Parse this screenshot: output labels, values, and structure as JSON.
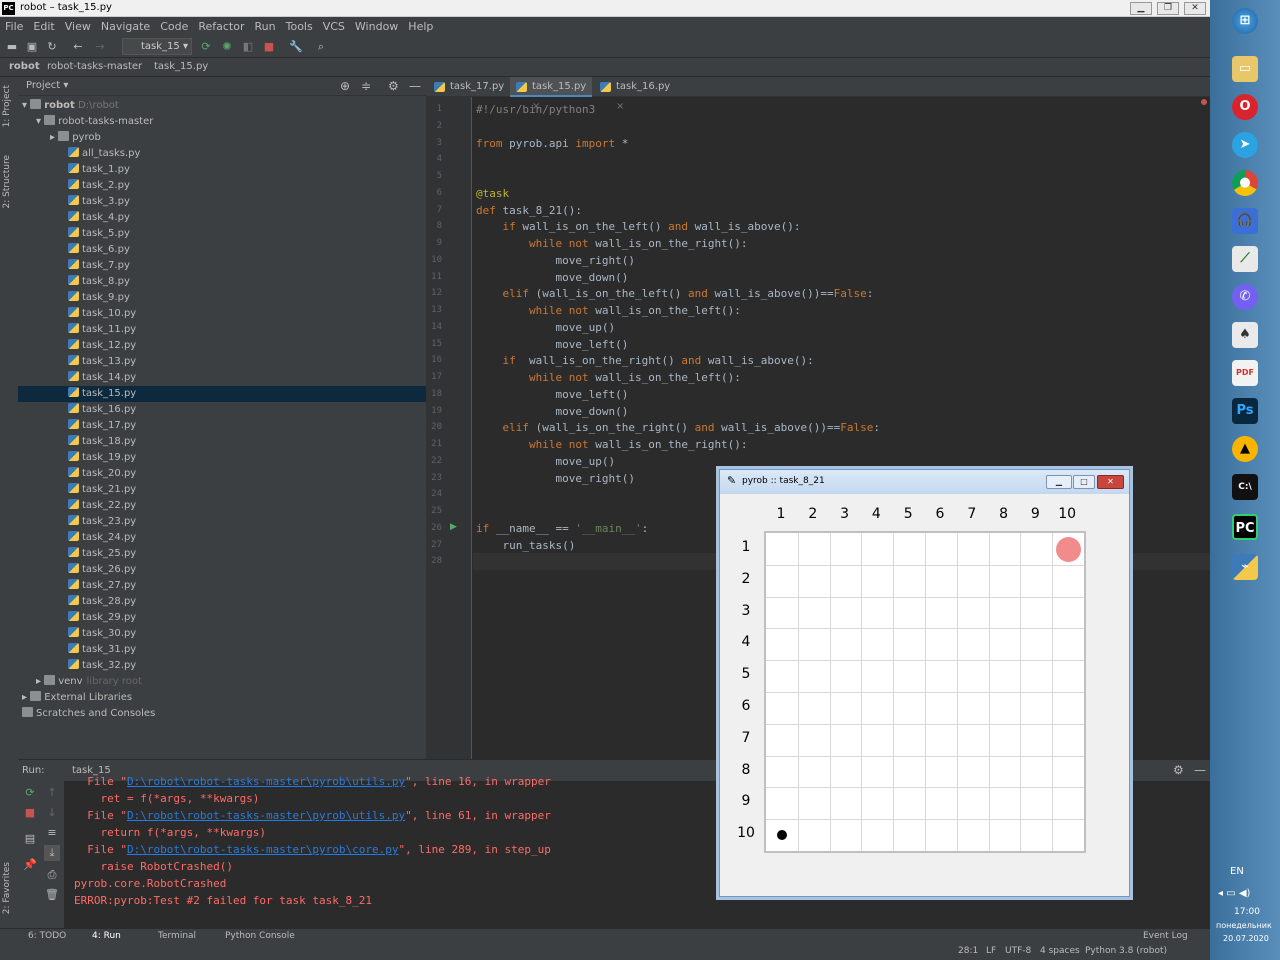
{
  "window": {
    "title": "robot – task_15.py",
    "app_icon": "PC"
  },
  "menu": [
    "File",
    "Edit",
    "View",
    "Navigate",
    "Code",
    "Refactor",
    "Run",
    "Tools",
    "VCS",
    "Window",
    "Help"
  ],
  "toolbar": {
    "run_config": "task_15"
  },
  "breadcrumbs": [
    "robot",
    "robot-tasks-master",
    "task_15.py"
  ],
  "left_tabs": [
    "1: Project",
    "2: Structure",
    "2: Favorites"
  ],
  "project": {
    "header": "Project",
    "root": {
      "name": "robot",
      "path": "D:\\robot"
    },
    "items": [
      {
        "label": "robot-tasks-master",
        "type": "dir",
        "indent": 1
      },
      {
        "label": "pyrob",
        "type": "dir",
        "indent": 2
      },
      {
        "label": "all_tasks.py",
        "type": "py",
        "indent": 3
      },
      {
        "label": "task_1.py",
        "type": "py",
        "indent": 3
      },
      {
        "label": "task_2.py",
        "type": "py",
        "indent": 3
      },
      {
        "label": "task_3.py",
        "type": "py",
        "indent": 3
      },
      {
        "label": "task_4.py",
        "type": "py",
        "indent": 3
      },
      {
        "label": "task_5.py",
        "type": "py",
        "indent": 3
      },
      {
        "label": "task_6.py",
        "type": "py",
        "indent": 3
      },
      {
        "label": "task_7.py",
        "type": "py",
        "indent": 3
      },
      {
        "label": "task_8.py",
        "type": "py",
        "indent": 3
      },
      {
        "label": "task_9.py",
        "type": "py",
        "indent": 3
      },
      {
        "label": "task_10.py",
        "type": "py",
        "indent": 3
      },
      {
        "label": "task_11.py",
        "type": "py",
        "indent": 3
      },
      {
        "label": "task_12.py",
        "type": "py",
        "indent": 3
      },
      {
        "label": "task_13.py",
        "type": "py",
        "indent": 3
      },
      {
        "label": "task_14.py",
        "type": "py",
        "indent": 3
      },
      {
        "label": "task_15.py",
        "type": "py",
        "indent": 3,
        "selected": true
      },
      {
        "label": "task_16.py",
        "type": "py",
        "indent": 3
      },
      {
        "label": "task_17.py",
        "type": "py",
        "indent": 3
      },
      {
        "label": "task_18.py",
        "type": "py",
        "indent": 3
      },
      {
        "label": "task_19.py",
        "type": "py",
        "indent": 3
      },
      {
        "label": "task_20.py",
        "type": "py",
        "indent": 3
      },
      {
        "label": "task_21.py",
        "type": "py",
        "indent": 3
      },
      {
        "label": "task_22.py",
        "type": "py",
        "indent": 3
      },
      {
        "label": "task_23.py",
        "type": "py",
        "indent": 3
      },
      {
        "label": "task_24.py",
        "type": "py",
        "indent": 3
      },
      {
        "label": "task_25.py",
        "type": "py",
        "indent": 3
      },
      {
        "label": "task_26.py",
        "type": "py",
        "indent": 3
      },
      {
        "label": "task_27.py",
        "type": "py",
        "indent": 3
      },
      {
        "label": "task_28.py",
        "type": "py",
        "indent": 3
      },
      {
        "label": "task_29.py",
        "type": "py",
        "indent": 3
      },
      {
        "label": "task_30.py",
        "type": "py",
        "indent": 3
      },
      {
        "label": "task_31.py",
        "type": "py",
        "indent": 3
      },
      {
        "label": "task_32.py",
        "type": "py",
        "indent": 3
      },
      {
        "label": "venv",
        "type": "dir",
        "indent": 1,
        "note": "library root"
      },
      {
        "label": "External Libraries",
        "type": "lib",
        "indent": 0
      },
      {
        "label": "Scratches and Consoles",
        "type": "lib",
        "indent": 0
      }
    ]
  },
  "editor": {
    "tabs": [
      "task_17.py",
      "task_15.py",
      "task_16.py"
    ],
    "active_tab": 1,
    "lines": [
      "#!/usr/bin/python3",
      "",
      "from pyrob.api import *",
      "",
      "",
      "@task",
      "def task_8_21():",
      "    if wall_is_on_the_left() and wall_is_above():",
      "        while not wall_is_on_the_right():",
      "            move_right()",
      "            move_down()",
      "    elif (wall_is_on_the_left() and wall_is_above())==False:",
      "        while not wall_is_on_the_left():",
      "            move_up()",
      "            move_left()",
      "    if  wall_is_on_the_right() and wall_is_above():",
      "        while not wall_is_on_the_left():",
      "            move_left()",
      "            move_down()",
      "    elif (wall_is_on_the_right() and wall_is_above())==False:",
      "        while not wall_is_on_the_right():",
      "            move_up()",
      "            move_right()",
      "",
      "",
      "if __name__ == '__main__':",
      "    run_tasks()",
      ""
    ]
  },
  "run": {
    "label": "Run:",
    "config": "task_15",
    "output": [
      {
        "pre": "  File \"",
        "link": "D:\\robot\\robot-tasks-master\\pyrob\\utils.py",
        "post": "\", line 16, in wrapper"
      },
      {
        "pre": "    ret = f(*args, **kwargs)"
      },
      {
        "pre": "  File \"",
        "link": "D:\\robot\\robot-tasks-master\\pyrob\\utils.py",
        "post": "\", line 61, in wrapper"
      },
      {
        "pre": "    return f(*args, **kwargs)"
      },
      {
        "pre": "  File \"",
        "link": "D:\\robot\\robot-tasks-master\\pyrob\\core.py",
        "post": "\", line 289, in step_up"
      },
      {
        "pre": "    raise RobotCrashed()"
      },
      {
        "pre": "pyrob.core.RobotCrashed"
      },
      {
        "pre": "ERROR:pyrob:Test #2 failed for task task_8_21"
      }
    ]
  },
  "bottom_tabs": [
    "6: TODO",
    "4: Run",
    "Terminal",
    "Python Console"
  ],
  "event_log": "Event Log",
  "status": [
    "28:1",
    "LF",
    "UTF-8",
    "4 spaces",
    "Python 3.8 (robot)"
  ],
  "pyrob": {
    "title": "pyrob :: task_8_21",
    "cols": [
      "1",
      "2",
      "3",
      "4",
      "5",
      "6",
      "7",
      "8",
      "9",
      "10"
    ],
    "rows": [
      "1",
      "2",
      "3",
      "4",
      "5",
      "6",
      "7",
      "8",
      "9",
      "10"
    ],
    "target_cell": {
      "row": 1,
      "col": 10,
      "color": "#f28b8b"
    },
    "robot_cell": {
      "row": 10,
      "col": 1,
      "color": "#000000"
    }
  },
  "taskbar": {
    "lang": "EN",
    "time": "17:00",
    "day": "понедельник",
    "date": "20.07.2020"
  }
}
